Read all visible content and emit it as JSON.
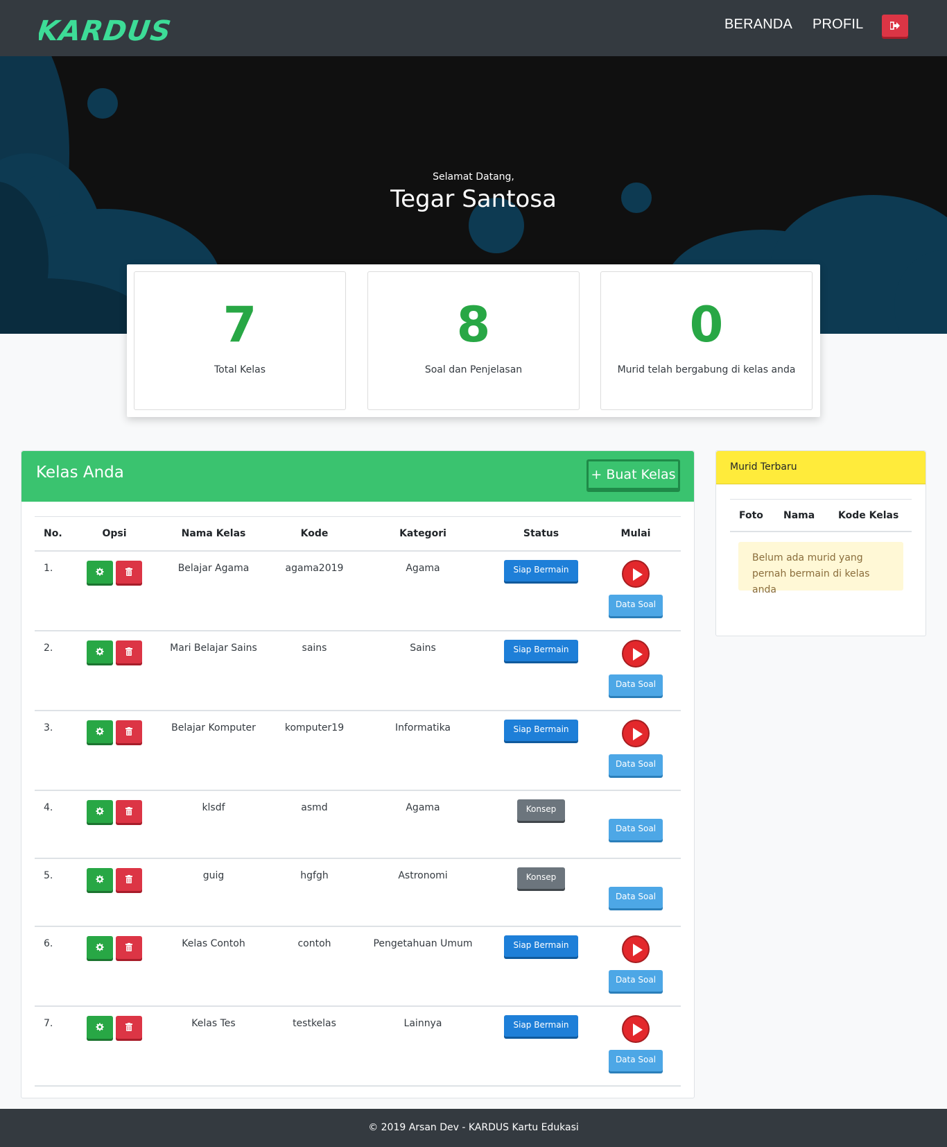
{
  "nav": {
    "logo_text": "KARDUS!",
    "beranda": "BERANDA",
    "profil": "PROFIL",
    "logout_icon": "sign-out-icon"
  },
  "hero": {
    "greeting": "Selamat Datang,",
    "user_name": "Tegar Santosa"
  },
  "stats": [
    {
      "value": "7",
      "label": "Total Kelas"
    },
    {
      "value": "8",
      "label": "Soal dan Penjelasan"
    },
    {
      "value": "0",
      "label": "Murid telah bergabung di kelas anda"
    }
  ],
  "classes": {
    "title": "Kelas Anda",
    "create_button": "+ Buat Kelas",
    "headers": [
      "No.",
      "Opsi",
      "Nama Kelas",
      "Kode",
      "Kategori",
      "Status",
      "Mulai"
    ],
    "data_soal_label": "Data Soal",
    "rows": [
      {
        "no": "1.",
        "name": "Belajar Agama",
        "code": "agama2019",
        "category": "Agama",
        "status": "Siap Bermain"
      },
      {
        "no": "2.",
        "name": "Mari Belajar Sains",
        "code": "sains",
        "category": "Sains",
        "status": "Siap Bermain"
      },
      {
        "no": "3.",
        "name": "Belajar Komputer",
        "code": "komputer19",
        "category": "Informatika",
        "status": "Siap Bermain"
      },
      {
        "no": "4.",
        "name": "klsdf",
        "code": "asmd",
        "category": "Agama",
        "status": "Konsep"
      },
      {
        "no": "5.",
        "name": "guig",
        "code": "hgfgh",
        "category": "Astronomi",
        "status": "Konsep"
      },
      {
        "no": "6.",
        "name": "Kelas Contoh",
        "code": "contoh",
        "category": "Pengetahuan Umum",
        "status": "Siap Bermain"
      },
      {
        "no": "7.",
        "name": "Kelas Tes",
        "code": "testkelas",
        "category": "Lainnya",
        "status": "Siap Bermain"
      }
    ]
  },
  "recent": {
    "title": "Murid Terbaru",
    "headers": [
      "Foto",
      "Nama",
      "Kode Kelas"
    ],
    "empty_message": "Belum ada murid yang pernah bermain di kelas anda"
  },
  "footer": {
    "text": "© 2019 Arsan Dev - KARDUS Kartu Edukasi"
  },
  "colors": {
    "navbar": "#343a40",
    "hero_bg": "#101010",
    "hero_bubbles": "#0d3a52",
    "accent_green": "#3ac36f",
    "stat_green": "#28a745",
    "danger": "#dc3545",
    "primary_blue": "#1e7fd8",
    "info_blue": "#4da7e6",
    "side_header_yellow": "#ffeb3b"
  }
}
